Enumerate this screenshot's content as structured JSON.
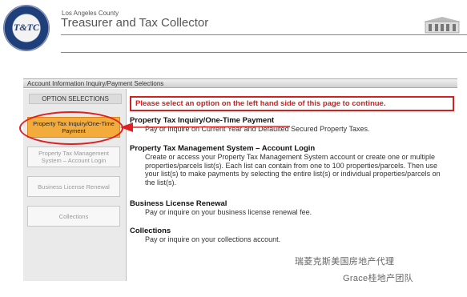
{
  "header": {
    "seal_text": "T&TC",
    "county": "Los Angeles County",
    "office": "Treasurer and Tax Collector"
  },
  "panel": {
    "title": "Account Information Inquiry/Payment Selections"
  },
  "sidebar": {
    "title": "OPTION SELECTIONS",
    "items": [
      {
        "label": "Property Tax Inquiry/One-Time Payment",
        "state": "selected"
      },
      {
        "label": "Property Tax Management System – Account Login",
        "state": "disabled"
      },
      {
        "label": "Business License Renewal",
        "state": "disabled"
      },
      {
        "label": "Collections",
        "state": "disabled"
      }
    ]
  },
  "alert": "Please select an option on the left hand side of this page to continue.",
  "sections": [
    {
      "title": "Property Tax Inquiry/One-Time Payment",
      "text": "Pay or inquire on Current Year and Defaulted Secured Property Taxes."
    },
    {
      "title": "Property Tax Management System – Account Login",
      "text": "Create or access your Property Tax Management System account or create one or multiple properties/parcels list(s). Each list can contain from one to 100 properties/parcels. Then use your list(s) to make payments by selecting the entire list(s) or individual properties/parcels on the list(s)."
    },
    {
      "title": "Business License Renewal",
      "text": "Pay or inquire on your business license renewal fee."
    },
    {
      "title": "Collections",
      "text": "Pay or inquire on your collections account."
    }
  ],
  "watermark": {
    "line1": "瑞菱克斯美国房地产代理",
    "line2": "Grace桂地产团队"
  },
  "colors": {
    "accent": "#f3ac3c",
    "alert": "#d21f1f",
    "rule": "#7a83b5"
  }
}
